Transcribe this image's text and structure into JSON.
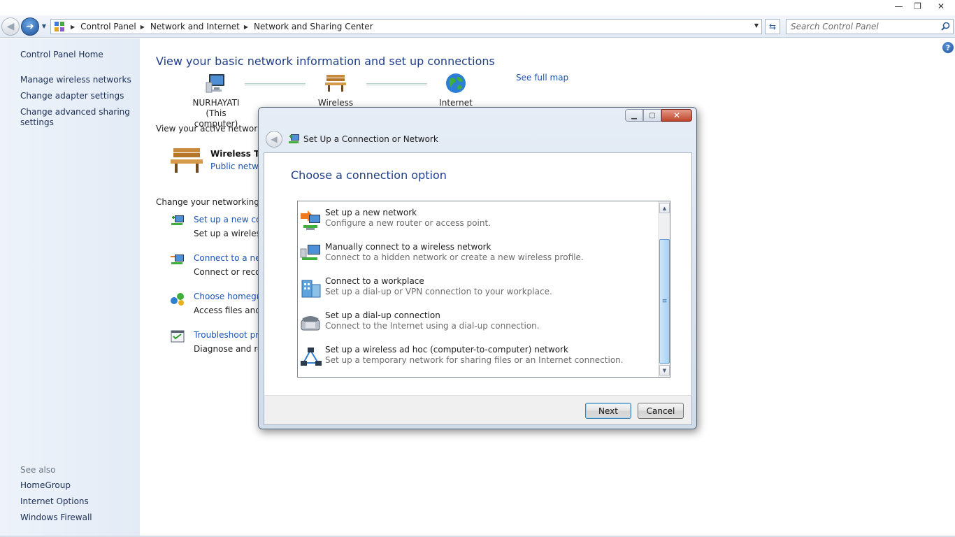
{
  "window": {
    "minimize_glyph": "—",
    "restore_glyph": "❐",
    "close_glyph": "✕"
  },
  "addressbar": {
    "crumbs": [
      "Control Panel",
      "Network and Internet",
      "Network and Sharing Center"
    ],
    "search_placeholder": "Search Control Panel"
  },
  "sidebar": {
    "home": "Control Panel Home",
    "items": [
      "Manage wireless networks",
      "Change adapter settings",
      "Change advanced sharing settings"
    ],
    "see_also_label": "See also",
    "see_also": [
      "HomeGroup",
      "Internet Options",
      "Windows Firewall"
    ]
  },
  "main": {
    "title": "View your basic network information and set up connections",
    "see_full_map": "See full map",
    "map": {
      "computer_name": "NURHAYATI",
      "computer_sub": "(This computer)",
      "middle": "Wireless Terminal",
      "internet": "Internet"
    },
    "active_networks_label": "View your active networks",
    "active_network": {
      "name": "Wireless Ter",
      "type": "Public netwo"
    },
    "change_settings_label": "Change your networking se",
    "tasks": [
      {
        "link": "Set up a new conn",
        "desc": "Set up a wireless, "
      },
      {
        "link": "Connect to a netw",
        "desc": "Connect or recon"
      },
      {
        "link": "Choose homegro",
        "desc": "Access files and p"
      },
      {
        "link": "Troubleshoot pro",
        "desc": "Diagnose and rep"
      }
    ]
  },
  "dialog": {
    "title": "Set Up a Connection or Network",
    "heading": "Choose a connection option",
    "options": [
      {
        "title": "Set up a new network",
        "desc": "Configure a new router or access point."
      },
      {
        "title": "Manually connect to a wireless network",
        "desc": "Connect to a hidden network or create a new wireless profile."
      },
      {
        "title": "Connect to a workplace",
        "desc": "Set up a dial-up or VPN connection to your workplace."
      },
      {
        "title": "Set up a dial-up connection",
        "desc": "Connect to the Internet using a dial-up connection."
      },
      {
        "title": "Set up a wireless ad hoc (computer-to-computer) network",
        "desc": "Set up a temporary network for sharing files or an Internet connection."
      }
    ],
    "next_label": "Next",
    "cancel_label": "Cancel"
  },
  "colors": {
    "link": "#1a53b4",
    "heading": "#1e3d8a",
    "sidebar_bg": "#e8eff8"
  }
}
